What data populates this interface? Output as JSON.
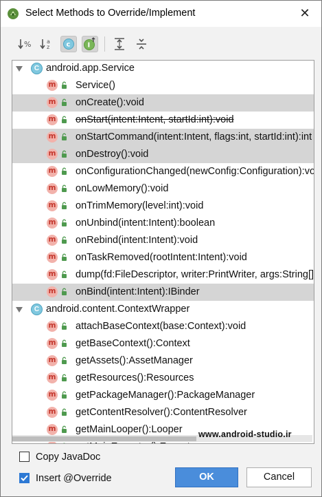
{
  "dialog": {
    "title": "Select Methods to Override/Implement",
    "close_label": "✕"
  },
  "toolbar": {
    "icons": [
      "sort-by-visibility-icon",
      "sort-alphabetically-icon",
      "show-classes-icon",
      "show-interfaces-icon",
      "expand-all-icon",
      "collapse-all-icon"
    ],
    "labels": [
      "↓%",
      "↓ᵃz",
      "C",
      "I"
    ]
  },
  "tree": {
    "groups": [
      {
        "label": "android.app.Service",
        "class_letter": "C",
        "methods": [
          {
            "label": "Service()",
            "selected": false,
            "deprecated": false
          },
          {
            "label": "onCreate():void",
            "selected": true,
            "deprecated": false
          },
          {
            "label": "onStart(intent:Intent, startId:int):void",
            "selected": false,
            "deprecated": true
          },
          {
            "label": "onStartCommand(intent:Intent, flags:int, startId:int):int",
            "selected": true,
            "deprecated": false
          },
          {
            "label": "onDestroy():void",
            "selected": true,
            "deprecated": false
          },
          {
            "label": "onConfigurationChanged(newConfig:Configuration):void",
            "selected": false,
            "deprecated": false
          },
          {
            "label": "onLowMemory():void",
            "selected": false,
            "deprecated": false
          },
          {
            "label": "onTrimMemory(level:int):void",
            "selected": false,
            "deprecated": false
          },
          {
            "label": "onUnbind(intent:Intent):boolean",
            "selected": false,
            "deprecated": false
          },
          {
            "label": "onRebind(intent:Intent):void",
            "selected": false,
            "deprecated": false
          },
          {
            "label": "onTaskRemoved(rootIntent:Intent):void",
            "selected": false,
            "deprecated": false
          },
          {
            "label": "dump(fd:FileDescriptor, writer:PrintWriter, args:String[]):void",
            "selected": false,
            "deprecated": false
          },
          {
            "label": "onBind(intent:Intent):IBinder",
            "selected": true,
            "deprecated": false
          }
        ]
      },
      {
        "label": "android.content.ContextWrapper",
        "class_letter": "C",
        "methods": [
          {
            "label": "attachBaseContext(base:Context):void",
            "selected": false,
            "deprecated": false
          },
          {
            "label": "getBaseContext():Context",
            "selected": false,
            "deprecated": false
          },
          {
            "label": "getAssets():AssetManager",
            "selected": false,
            "deprecated": false
          },
          {
            "label": "getResources():Resources",
            "selected": false,
            "deprecated": false
          },
          {
            "label": "getPackageManager():PackageManager",
            "selected": false,
            "deprecated": false
          },
          {
            "label": "getContentResolver():ContentResolver",
            "selected": false,
            "deprecated": false
          },
          {
            "label": "getMainLooper():Looper",
            "selected": false,
            "deprecated": false
          },
          {
            "label": "getMainExecutor():Executor",
            "selected": false,
            "deprecated": false
          }
        ]
      }
    ]
  },
  "watermark": "www.android-studio.ir",
  "options": {
    "copy_javadoc": {
      "label": "Copy JavaDoc",
      "checked": false
    },
    "insert_override": {
      "label": "Insert @Override",
      "checked": true
    }
  },
  "buttons": {
    "ok": "OK",
    "cancel": "Cancel"
  },
  "colors": {
    "accent": "#4a8ddb",
    "selection": "#d5d5d5",
    "method_icon": "#f2b2ab",
    "class_icon": "#80c8df"
  }
}
